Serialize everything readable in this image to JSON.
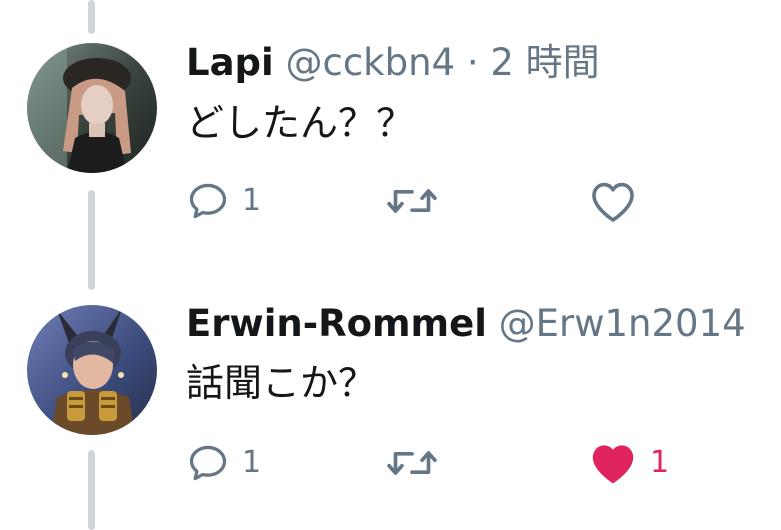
{
  "tweets": [
    {
      "name": "Lapi",
      "handle": "@cckbn4",
      "separator": "·",
      "time": "2 時間",
      "text": "どしたん？？",
      "avatar_icon": "user-avatar-photo",
      "actions": {
        "reply_count": "1",
        "retweet_count": "",
        "like_count": "",
        "liked": false
      }
    },
    {
      "name": "Erwin-Rommel",
      "handle": "@Erw1n2014",
      "text": "話聞こか？",
      "avatar_icon": "user-avatar-photo",
      "actions": {
        "reply_count": "1",
        "retweet_count": "",
        "like_count": "1",
        "liked": true
      }
    }
  ],
  "colors": {
    "text_primary": "#14171a",
    "text_secondary": "#657786",
    "like_active": "#e0245e",
    "thread_line": "#d1d5da"
  }
}
